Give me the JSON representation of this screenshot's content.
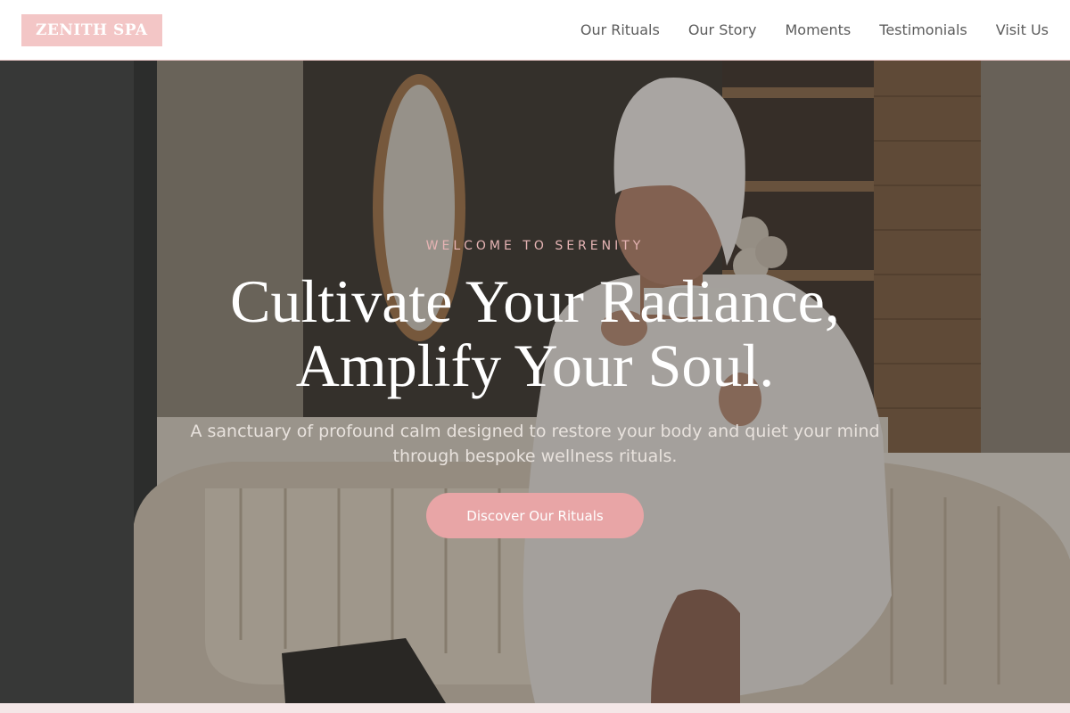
{
  "header": {
    "logo": "ZENITH SPA",
    "nav": [
      "Our Rituals",
      "Our Story",
      "Moments",
      "Testimonials",
      "Visit Us"
    ]
  },
  "hero": {
    "eyebrow": "WELCOME TO SERENITY",
    "headline_line1": "Cultivate Your Radiance,",
    "headline_line2": "Amplify Your Soul.",
    "subheadline_line1": "A sanctuary of profound calm designed to restore your body and quiet your mind",
    "subheadline_line2": "through bespoke wellness rituals.",
    "cta": "Discover Our Rituals",
    "image_description": "spa-lounge-woman-in-towel-and-robe-with-cup"
  },
  "colors": {
    "accent": "#e8a5a6",
    "logo_bg": "#f3c6c6",
    "nav_text": "#5c5c5c",
    "eyebrow": "#e6b4b4"
  }
}
